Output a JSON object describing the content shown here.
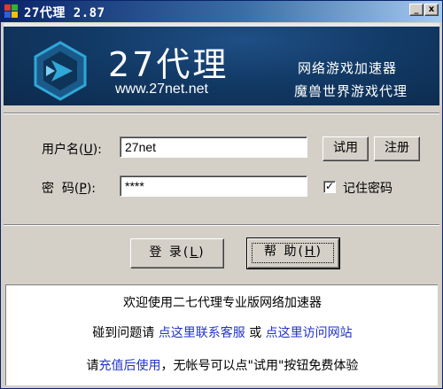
{
  "window": {
    "title": "27代理 2.87",
    "min_label": "_",
    "close_label": "x"
  },
  "banner": {
    "title": "27代理",
    "url": "www.27net.net",
    "tagline_1": "网络游戏加速器",
    "tagline_2": "魔兽世界游戏代理"
  },
  "form": {
    "username_label_pre": "用户名(",
    "username_label_key": "U",
    "username_label_post": "):",
    "username_value": "27net",
    "password_label_pre": "密  码(",
    "password_label_key": "P",
    "password_label_post": "):",
    "password_value": "****",
    "trial_button": "试用",
    "register_button": "注册",
    "remember_label": "记住密码",
    "remember_checked": true,
    "login_button_pre": "登 录(",
    "login_button_key": "L",
    "login_button_post": ")",
    "help_button_pre": "帮 助(",
    "help_button_key": "H",
    "help_button_post": ")"
  },
  "info": {
    "welcome": "欢迎使用二七代理专业版网络加速器",
    "problem_pre": "碰到问题请 ",
    "support_link": "点这里联系客服",
    "or_text": " 或 ",
    "website_link": "点这里访问网站",
    "please_text": "请",
    "recharge_link": "充值后使用",
    "trial_hint": "，无帐号可以点\"试用\"按钮免费体验"
  },
  "colors": {
    "title_bar_start": "#0a246a",
    "banner_bg": "#123a66",
    "link": "#2233cc",
    "logo_cyan": "#2fa8d8"
  }
}
